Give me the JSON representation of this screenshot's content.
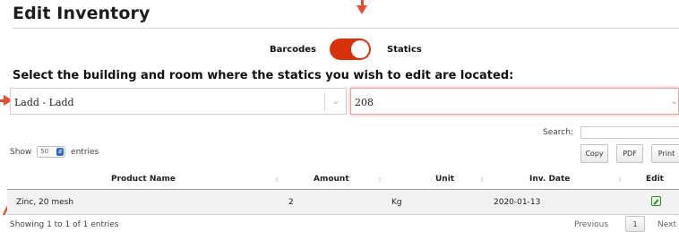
{
  "page": {
    "title": "Edit Inventory"
  },
  "toggle": {
    "left_label": "Barcodes",
    "right_label": "Statics",
    "state": "on",
    "color": "#d8320c"
  },
  "instruction": "Select the building and room where the statics you wish to edit are located:",
  "building_select": {
    "value": "Ladd - Ladd"
  },
  "room_select": {
    "value": "208"
  },
  "length_menu": {
    "prefix": "Show",
    "value": "50",
    "suffix": "entries"
  },
  "search": {
    "label": "Search:"
  },
  "buttons": {
    "copy": "Copy",
    "pdf": "PDF",
    "print": "Print"
  },
  "table": {
    "columns": [
      "Product Name",
      "Amount",
      "Unit",
      "Inv. Date",
      "Edit"
    ],
    "rows": [
      {
        "product": "Zinc, 20 mesh",
        "amount": "2",
        "unit": "Kg",
        "date": "2020-01-13"
      }
    ]
  },
  "info": "Showing 1 to 1 of 1 entries",
  "pagination": {
    "previous": "Previous",
    "current": "1",
    "next": "Next"
  },
  "accent_color": "#e94e2c"
}
